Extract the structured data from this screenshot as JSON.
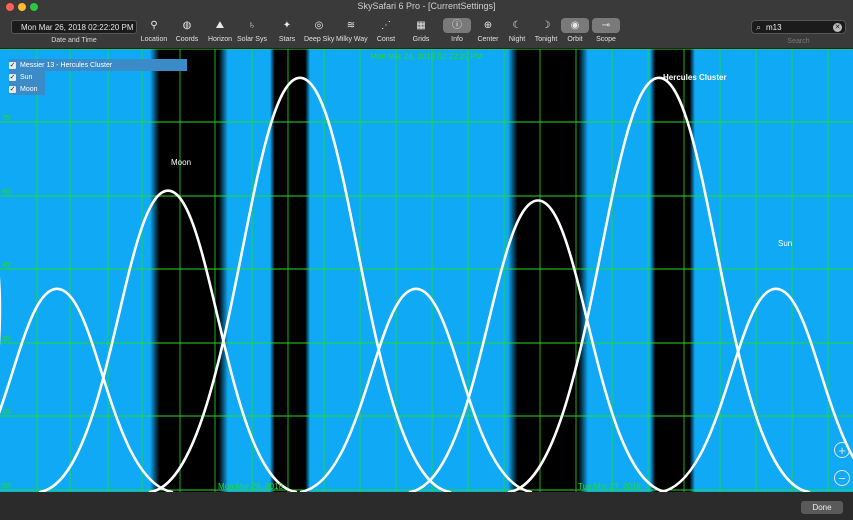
{
  "window": {
    "title": "SkySafari 6 Pro - [CurrentSettings]"
  },
  "toolbar": {
    "date_value": "Mon Mar 26, 2018  02:22:20 PM",
    "date_label": "Date and Time",
    "buttons": [
      {
        "label": "Location",
        "icon": "location-pin-icon",
        "glyph": "⚲"
      },
      {
        "label": "Coords",
        "icon": "globe-icon",
        "glyph": "◍"
      },
      {
        "label": "Horizon",
        "icon": "horizon-icon",
        "glyph": "⛰"
      },
      {
        "label": "Solar Sys",
        "icon": "planet-icon",
        "glyph": "♄"
      },
      {
        "label": "Stars",
        "icon": "stars-icon",
        "glyph": "✦"
      },
      {
        "label": "Deep Sky",
        "icon": "galaxy-icon",
        "glyph": "◎"
      },
      {
        "label": "Milky Way",
        "icon": "milky-way-icon",
        "glyph": "≋"
      },
      {
        "label": "Const",
        "icon": "constellation-icon",
        "glyph": "⋰"
      },
      {
        "label": "Grids",
        "icon": "grid-icon",
        "glyph": "▦"
      },
      {
        "label": "Info",
        "icon": "info-icon",
        "glyph": "ⓘ"
      },
      {
        "label": "Center",
        "icon": "center-icon",
        "glyph": "⊕"
      },
      {
        "label": "Night",
        "icon": "moon-icon",
        "glyph": "☾"
      },
      {
        "label": "Tonight",
        "icon": "tonight-icon",
        "glyph": "☽"
      },
      {
        "label": "Orbit",
        "icon": "orbit-icon",
        "glyph": "◉"
      },
      {
        "label": "Scope",
        "icon": "telescope-icon",
        "glyph": "⊸"
      }
    ],
    "search_value": "m13",
    "search_label": "Search"
  },
  "chart": {
    "date_header": "Mon Mar 26, 2018 02:22:20 PM",
    "legend": [
      {
        "label": "Messier 13 - Hercules Cluster",
        "checked": true
      },
      {
        "label": "Sun",
        "checked": true
      },
      {
        "label": "Moon",
        "checked": true
      }
    ],
    "curve_labels": {
      "hercules": "Hercules Cluster",
      "sun": "Sun",
      "moon": "Moon"
    },
    "y_ticks": [
      "75°",
      "60°",
      "45°",
      "30°",
      "15°",
      "00°"
    ],
    "x_ticks": [
      "Mon Mar 26, 2018",
      "Tue Mar 27, 2018"
    ],
    "colors": {
      "sky": "#0fa9f6",
      "night": "#000000",
      "grid": "#22dd22",
      "curve": "#ffffff"
    }
  },
  "chart_data": {
    "type": "line",
    "title": "Mon Mar 26, 2018 02:22:20 PM",
    "xlabel": "",
    "ylabel": "",
    "x_categories": [
      "Mon Mar 26, 2018",
      "Tue Mar 27, 2018"
    ],
    "ylim": [
      0,
      90
    ],
    "series": [
      {
        "name": "Hercules Cluster",
        "peaks": [
          {
            "x": "Mar 26 night",
            "altitude": 83
          },
          {
            "x": "Mar 27 night",
            "altitude": 83
          }
        ]
      },
      {
        "name": "Moon",
        "peaks": [
          {
            "x": "Mar 26 day",
            "altitude": 65
          },
          {
            "x": "Mar 27 day",
            "altitude": 63
          }
        ]
      },
      {
        "name": "Sun",
        "peaks": [
          {
            "x": "Mar 26 noon",
            "altitude": 47
          },
          {
            "x": "Mar 27 noon",
            "altitude": 47
          },
          {
            "x": "Mar 28 noon",
            "altitude": 47
          }
        ]
      }
    ],
    "grid": true
  },
  "footer": {
    "done_label": "Done"
  }
}
